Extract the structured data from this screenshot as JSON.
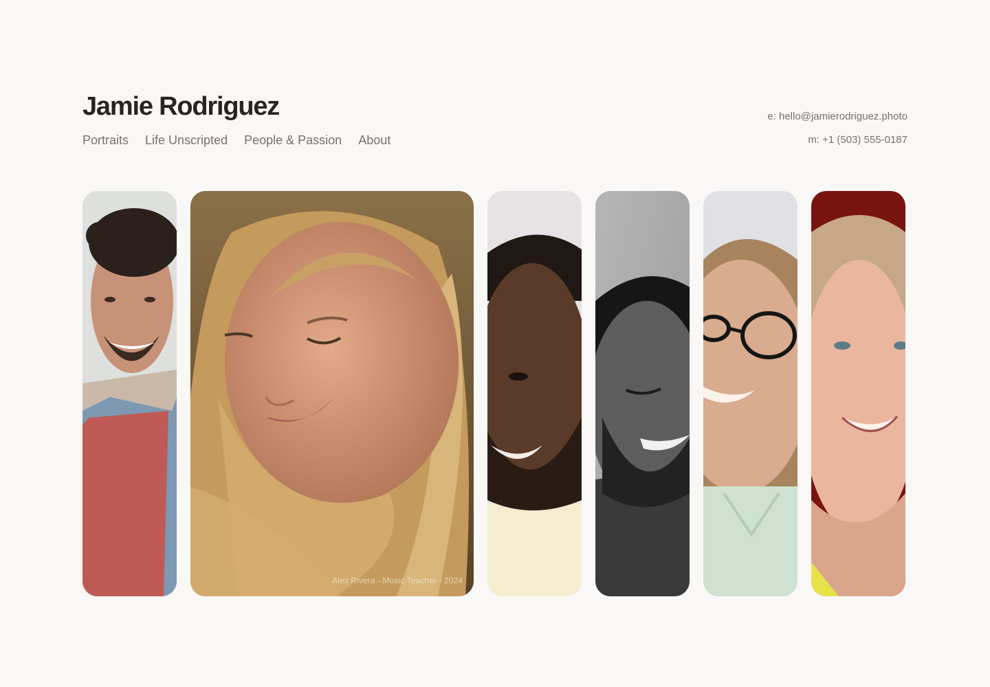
{
  "brand": {
    "name": "Jamie Rodriguez"
  },
  "nav": {
    "items": [
      {
        "label": "Portraits"
      },
      {
        "label": "Life Unscripted"
      },
      {
        "label": "People & Passion"
      },
      {
        "label": "About"
      }
    ]
  },
  "contact": {
    "email": "e: hello@jamierodriguez.photo",
    "phone": "m: +1 (503) 555-0187"
  },
  "gallery": {
    "featured_caption": "Alex Rivera - Music Teacher - 2024",
    "photos": [
      {
        "subject": "smiling-young-man-denim-jacket",
        "background": "#dfe2df"
      },
      {
        "subject": "blonde-woman-close-up",
        "background": "#9b7a4a"
      },
      {
        "subject": "smiling-man-cream-shirt",
        "background": "#e7e3e3"
      },
      {
        "subject": "laughing-man-black-and-white",
        "background": "#c4c4c4"
      },
      {
        "subject": "woman-with-glasses-mint-hoodie",
        "background": "#e1e1e4"
      },
      {
        "subject": "woman-red-background",
        "background": "#7a1410"
      }
    ]
  },
  "colors": {
    "page_background": "#faf8f6",
    "title": "#2a2420",
    "muted_text": "#7b6f68"
  }
}
